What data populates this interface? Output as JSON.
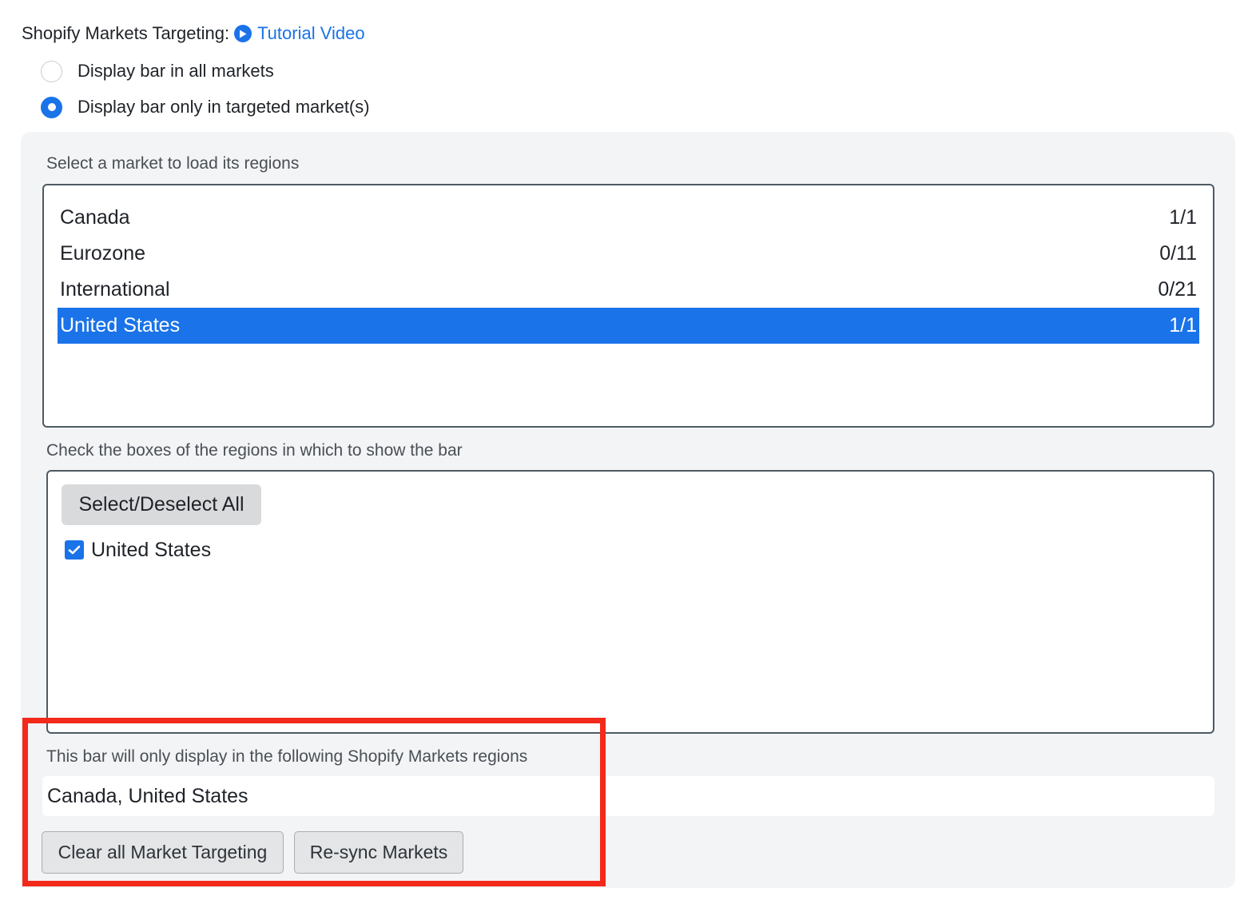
{
  "header": {
    "label": "Shopify Markets Targeting:",
    "tutorial_link": "Tutorial Video",
    "icon": "play-circle-icon",
    "link_color": "#1a73e8"
  },
  "display_options": [
    {
      "label": "Display bar in all markets",
      "checked": false
    },
    {
      "label": "Display bar only in targeted market(s)",
      "checked": true
    }
  ],
  "markets": {
    "label": "Select a market to load its regions",
    "items": [
      {
        "name": "Canada",
        "count": "1/1",
        "selected": false
      },
      {
        "name": "Eurozone",
        "count": "0/11",
        "selected": false
      },
      {
        "name": "International",
        "count": "0/21",
        "selected": false
      },
      {
        "name": "United States",
        "count": "1/1",
        "selected": true
      }
    ]
  },
  "regions": {
    "label": "Check the boxes of the regions in which to show the bar",
    "select_all_label": "Select/Deselect All",
    "items": [
      {
        "name": "United States",
        "checked": true
      }
    ]
  },
  "summary": {
    "label": "This bar will only display in the following Shopify Markets regions",
    "value": "Canada, United States"
  },
  "actions": {
    "clear_label": "Clear all Market Targeting",
    "resync_label": "Re-sync Markets"
  },
  "colors": {
    "accent": "#1a73e8",
    "highlight": "#f2291b",
    "panel_bg": "#f3f4f6"
  }
}
